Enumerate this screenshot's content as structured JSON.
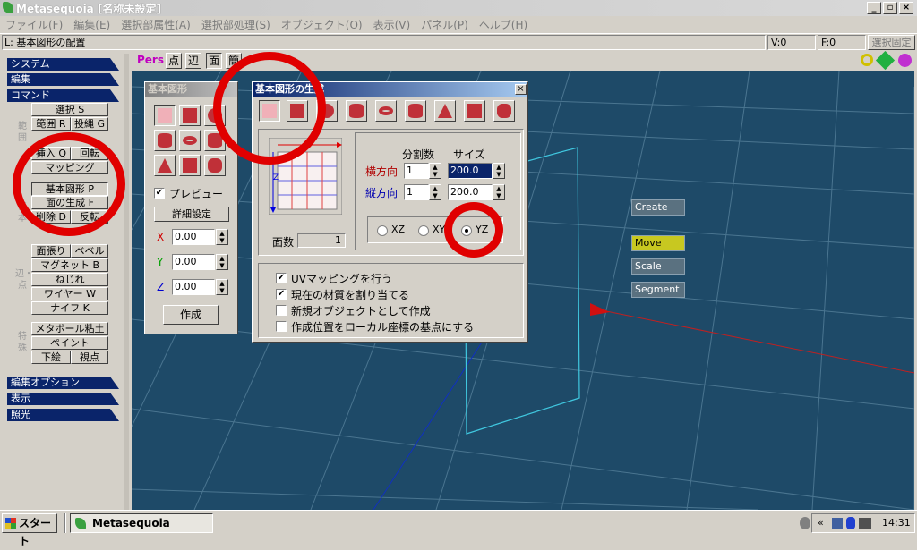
{
  "window": {
    "title": "Metasequoia [名称未設定]",
    "min": "_",
    "max": "▫",
    "close": "×"
  },
  "menu": [
    "ファイル(F)",
    "編集(E)",
    "選択部属性(A)",
    "選択部処理(S)",
    "オブジェクト(O)",
    "表示(V)",
    "パネル(P)",
    "ヘルプ(H)"
  ],
  "status": {
    "mode": "L: 基本図形の配置",
    "vertex": "V:0",
    "face": "F:0",
    "lock": "選択固定"
  },
  "left": {
    "tabs": {
      "system": "システム",
      "edit": "編集",
      "command": "コマンド",
      "edit_option": "編集オプション",
      "display": "表示",
      "lighting": "照光"
    },
    "group_range": "範囲",
    "group_basic": "基本",
    "group_edge": "辺・点",
    "group_special": "特殊",
    "buttons": {
      "select": "選択 S",
      "range": "範囲 R",
      "rope": "投縄 G",
      "insert": "挿入 Q",
      "rotate": "回転",
      "mapping": "マッピング",
      "primitive": "基本図形 P",
      "face_gen": "面の生成 F",
      "delete": "削除 D",
      "reverse": "反転",
      "face_paste": "面張り",
      "bevel": "ベベル",
      "magnet": "マグネット B",
      "twist": "ねじれ",
      "wire": "ワイヤー W",
      "knife": "ナイフ K",
      "metaball": "メタボール粘土",
      "paint": "ペイント",
      "underlay": "下絵",
      "viewpoint": "視点"
    }
  },
  "viewtoolbar": {
    "pers": "Pers",
    "point": "点",
    "edge": "辺",
    "face": "面",
    "more": "簡"
  },
  "basic_panel": {
    "title": "基本図形",
    "preview": "プレビュー",
    "detail": "詳細設定",
    "x_label": "X",
    "x": "0.00",
    "y_label": "Y",
    "y": "0.00",
    "z_label": "Z",
    "z": "0.00",
    "create": "作成"
  },
  "gen_dialog": {
    "title": "基本図形の生成",
    "close": "×",
    "divisions": "分割数",
    "size": "サイズ",
    "horizontal": "横方向",
    "vertical": "縦方向",
    "h_div": "1",
    "h_size": "200.0",
    "v_div": "1",
    "v_size": "200.0",
    "faces_label": "面数",
    "faces": "1",
    "planes": [
      "XZ",
      "XY",
      "YZ"
    ],
    "selected_plane": "YZ",
    "preview_axis": "Z",
    "opt_uv": "UVマッピングを行う",
    "opt_material": "現在の材質を割り当てる",
    "opt_new": "新規オブジェクトとして作成",
    "opt_local": "作成位置をローカル座標の基点にする"
  },
  "viewport_cmds": {
    "create": "Create",
    "move": "Move",
    "scale": "Scale",
    "segment": "Segment"
  },
  "taskbar": {
    "start": "スタート",
    "app": "Metasequoia",
    "time": "14:31",
    "chev": "«"
  },
  "colors": {
    "grid": "#1e4a68",
    "title_active": "#0a246a",
    "highlight_ring": "#e00000",
    "move_active": "#c8c820"
  }
}
